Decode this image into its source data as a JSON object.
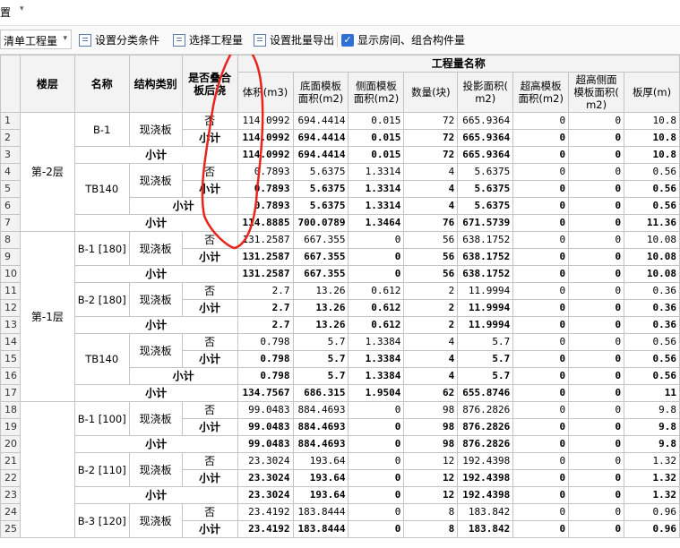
{
  "topbar": {
    "title": "置",
    "caret": "▾"
  },
  "toolbar": {
    "list_select": "清单工程量",
    "set_category": "设置分类条件",
    "choose_quantity": "选择工程量",
    "batch_export": "设置批量导出",
    "show_rooms": "显示房间、组合构件量",
    "show_rooms_checked": true
  },
  "headers": {
    "floor": "楼层",
    "name": "名称",
    "struct": "结构类别",
    "post_pour_1": "是否叠合",
    "post_pour_2": "板后浇",
    "group": "工程量名称",
    "volume": "体积(m3)",
    "bottom_1": "底面模板",
    "bottom_2": "面积(m2)",
    "side_1": "侧面模板",
    "side_2": "面积(m2)",
    "count": "数量(块)",
    "proj_1": "投影面积(",
    "proj_2": "m2)",
    "over_1": "超高模板",
    "over_2": "面积(m2)",
    "overside_1": "超高侧面",
    "overside_2": "模板面积(",
    "overside_3": "m2)",
    "thick": "板厚(m)"
  },
  "labels": {
    "no": "否",
    "subtotal": "小计"
  },
  "floors": {
    "f2": "第-2层",
    "f1": "第-1层"
  },
  "names": {
    "b1": "B-1",
    "tb140a": "TB140",
    "b1_180": "B-1 [180]",
    "b2_180": "B-2 [180]",
    "tb140b": "TB140",
    "b1_100": "B-1 [100]",
    "b2_110": "B-2 [110]",
    "b3_120": "B-3 [120]"
  },
  "struct": "现浇板",
  "rows": [
    [
      "1",
      "114.0992",
      "694.4414",
      "0.015",
      "72",
      "665.9364",
      "0",
      "0",
      "10.8"
    ],
    [
      "2",
      "114.0992",
      "694.4414",
      "0.015",
      "72",
      "665.9364",
      "0",
      "0",
      "10.8"
    ],
    [
      "3",
      "114.0992",
      "694.4414",
      "0.015",
      "72",
      "665.9364",
      "0",
      "0",
      "10.8"
    ],
    [
      "4",
      "0.7893",
      "5.6375",
      "1.3314",
      "4",
      "5.6375",
      "0",
      "0",
      "0.56"
    ],
    [
      "5",
      "0.7893",
      "5.6375",
      "1.3314",
      "4",
      "5.6375",
      "0",
      "0",
      "0.56"
    ],
    [
      "6",
      "0.7893",
      "5.6375",
      "1.3314",
      "4",
      "5.6375",
      "0",
      "0",
      "0.56"
    ],
    [
      "7",
      "114.8885",
      "700.0789",
      "1.3464",
      "76",
      "671.5739",
      "0",
      "0",
      "11.36"
    ],
    [
      "8",
      "131.2587",
      "667.355",
      "0",
      "56",
      "638.1752",
      "0",
      "0",
      "10.08"
    ],
    [
      "9",
      "131.2587",
      "667.355",
      "0",
      "56",
      "638.1752",
      "0",
      "0",
      "10.08"
    ],
    [
      "10",
      "131.2587",
      "667.355",
      "0",
      "56",
      "638.1752",
      "0",
      "0",
      "10.08"
    ],
    [
      "11",
      "2.7",
      "13.26",
      "0.612",
      "2",
      "11.9994",
      "0",
      "0",
      "0.36"
    ],
    [
      "12",
      "2.7",
      "13.26",
      "0.612",
      "2",
      "11.9994",
      "0",
      "0",
      "0.36"
    ],
    [
      "13",
      "2.7",
      "13.26",
      "0.612",
      "2",
      "11.9994",
      "0",
      "0",
      "0.36"
    ],
    [
      "14",
      "0.798",
      "5.7",
      "1.3384",
      "4",
      "5.7",
      "0",
      "0",
      "0.56"
    ],
    [
      "15",
      "0.798",
      "5.7",
      "1.3384",
      "4",
      "5.7",
      "0",
      "0",
      "0.56"
    ],
    [
      "16",
      "0.798",
      "5.7",
      "1.3384",
      "4",
      "5.7",
      "0",
      "0",
      "0.56"
    ],
    [
      "17",
      "134.7567",
      "686.315",
      "1.9504",
      "62",
      "655.8746",
      "0",
      "0",
      "11"
    ],
    [
      "18",
      "99.0483",
      "884.4693",
      "0",
      "98",
      "876.2826",
      "0",
      "0",
      "9.8"
    ],
    [
      "19",
      "99.0483",
      "884.4693",
      "0",
      "98",
      "876.2826",
      "0",
      "0",
      "9.8"
    ],
    [
      "20",
      "99.0483",
      "884.4693",
      "0",
      "98",
      "876.2826",
      "0",
      "0",
      "9.8"
    ],
    [
      "21",
      "23.3024",
      "193.64",
      "0",
      "12",
      "192.4398",
      "0",
      "0",
      "1.32"
    ],
    [
      "22",
      "23.3024",
      "193.64",
      "0",
      "12",
      "192.4398",
      "0",
      "0",
      "1.32"
    ],
    [
      "23",
      "23.3024",
      "193.64",
      "0",
      "12",
      "192.4398",
      "0",
      "0",
      "1.32"
    ],
    [
      "24",
      "23.4192",
      "183.8444",
      "0",
      "8",
      "183.842",
      "0",
      "0",
      "0.96"
    ],
    [
      "25",
      "23.4192",
      "183.8444",
      "0",
      "8",
      "183.842",
      "0",
      "0",
      "0.96"
    ]
  ],
  "colors": {
    "annotation": "#e8241c",
    "checkbox": "#2f6fd6"
  }
}
